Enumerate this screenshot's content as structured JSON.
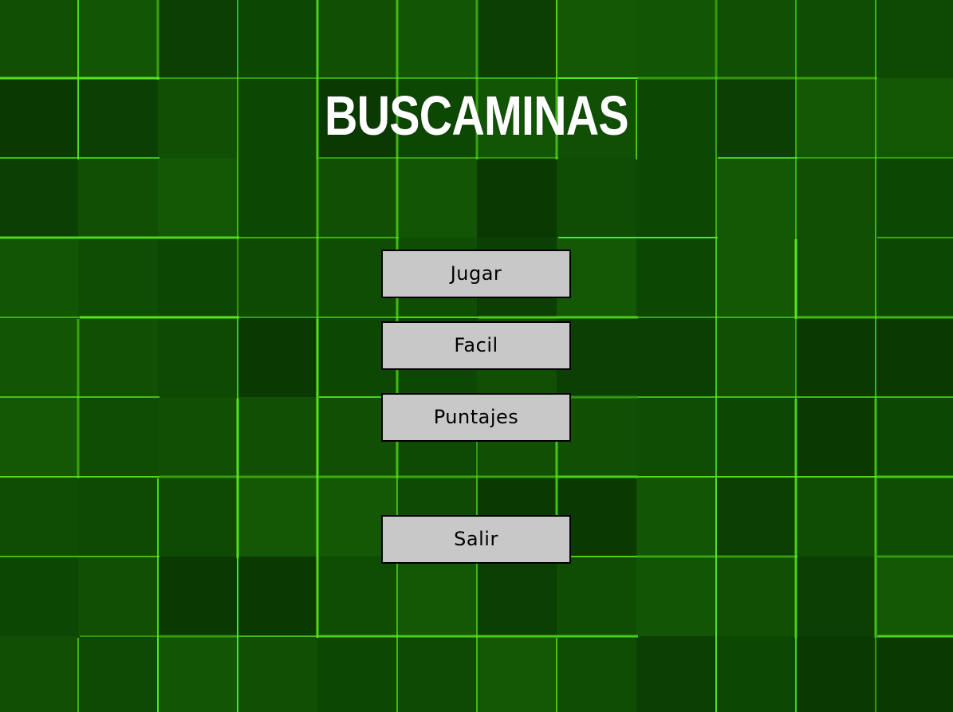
{
  "app": {
    "title": "BUSCAMINAS"
  },
  "menu": {
    "play_label": "Jugar",
    "difficulty_label": "Facil",
    "scores_label": "Puntajes",
    "exit_label": "Salir"
  },
  "colors": {
    "background_base": "#0f4d04",
    "grid_line": "#5ff01c",
    "button_bg": "#c8c8c8",
    "button_border": "#000000",
    "title_text": "#ffffff"
  }
}
